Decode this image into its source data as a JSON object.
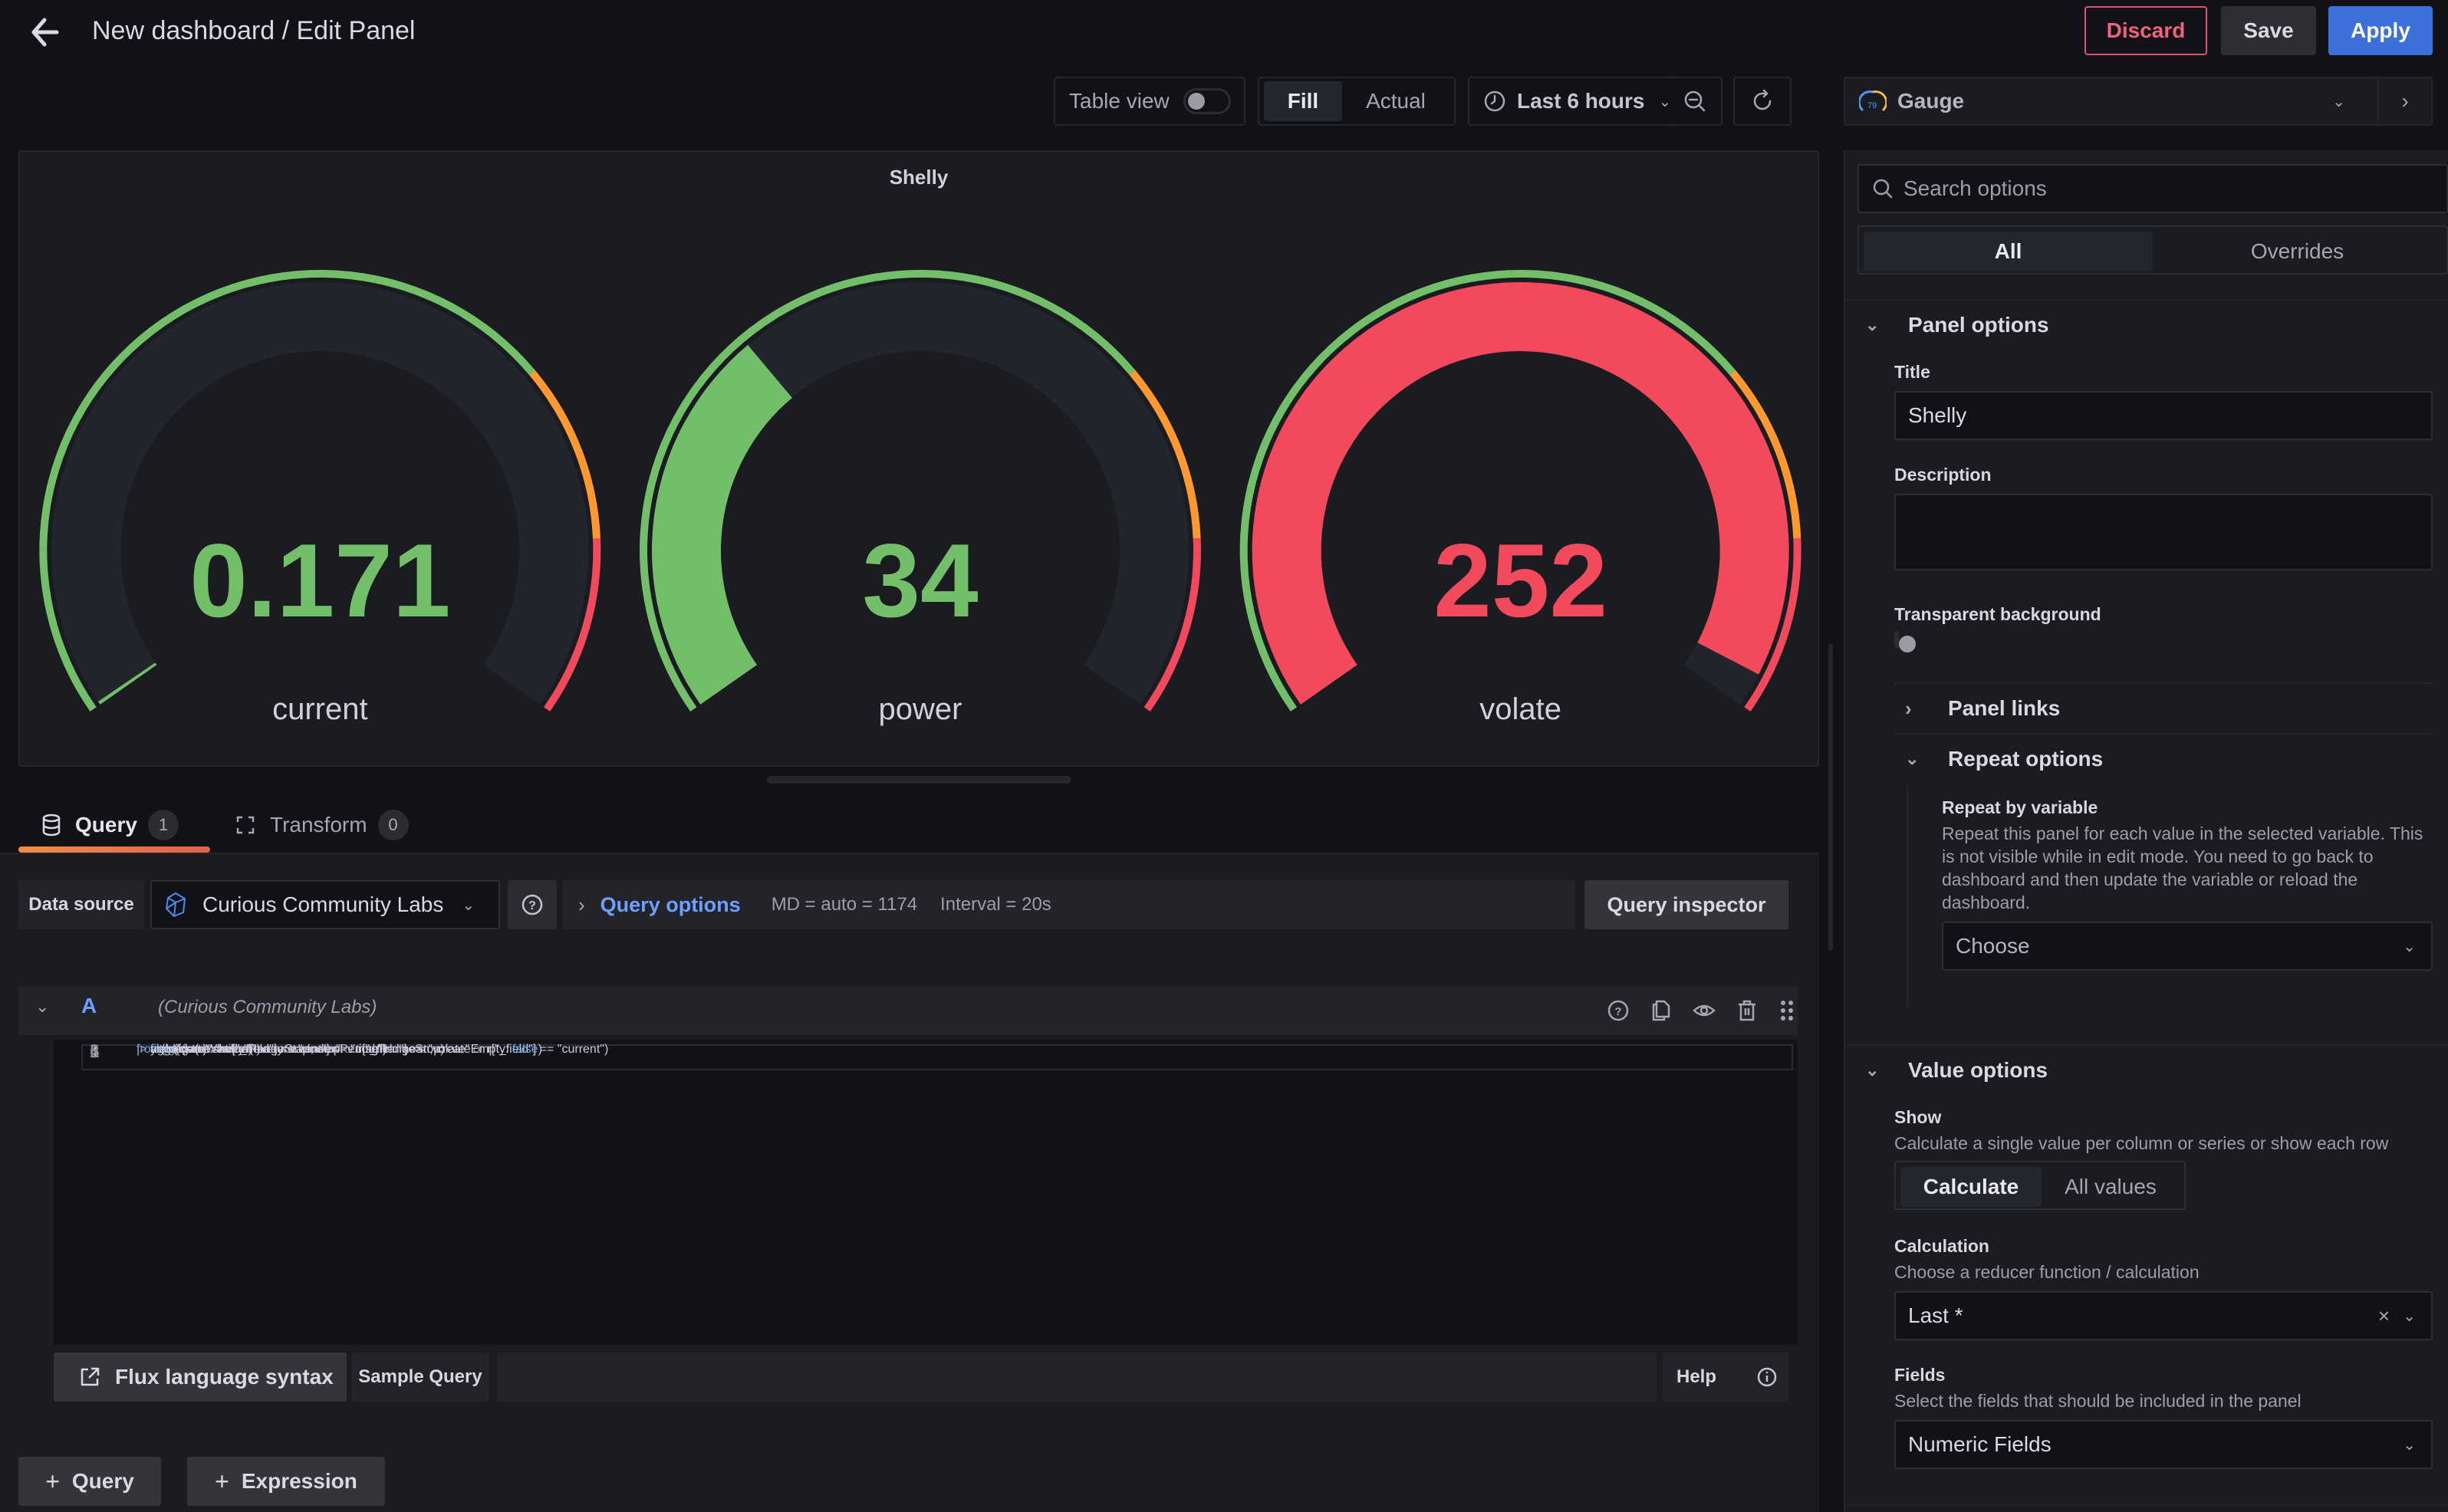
{
  "header": {
    "title": "New dashboard / Edit Panel",
    "discard_label": "Discard",
    "save_label": "Save",
    "apply_label": "Apply"
  },
  "toolbar": {
    "table_view_label": "Table view",
    "table_view_on": false,
    "fill_label": "Fill",
    "actual_label": "Actual",
    "time_range": "Last 6 hours",
    "visualization": "Gauge"
  },
  "panel": {
    "title": "Shelly",
    "gauges": [
      {
        "name": "current",
        "display": "0.171",
        "value": 0.171,
        "min": 0,
        "max": 100,
        "color": "#73bf69"
      },
      {
        "name": "power",
        "display": "34",
        "value": 34,
        "min": 0,
        "max": 100,
        "color": "#73bf69"
      },
      {
        "name": "volate",
        "display": "252",
        "value": 252,
        "min": 0,
        "max": 100,
        "color": "#f2495c"
      }
    ],
    "thresholds": [
      {
        "from_fraction": 0,
        "color": "#73bf69"
      },
      {
        "from_fraction": 0.7,
        "color": "#ff9830"
      },
      {
        "from_fraction": 0.85,
        "color": "#f2495c"
      }
    ]
  },
  "tabs": [
    {
      "label": "Query",
      "count": "1",
      "active": true
    },
    {
      "label": "Transform",
      "count": "0",
      "active": false
    }
  ],
  "query": {
    "data_source_label": "Data source",
    "data_source": "Curious Community Labs",
    "query_options_label": "Query options",
    "md": "MD = auto = 1174",
    "interval": "Interval = 20s",
    "inspector_label": "Query inspector",
    "row_letter": "A",
    "row_datasource": "(Curious Community Labs)",
    "code_lines": [
      "from(bucket: \"shelly\")",
      "  |> range(start: v.timeRangeStart, stop: v.timeRangeStop)",
      "  |> filter(fn: (r) => r[\"_measurement\"] == \"msg\")",
      "  |> filter(fn: (r) => r[\"_field\"] == \"power\" or r[\"_field\"] == \"volate\" or r[\"_field\"] == \"current\")",
      "  |> aggregateWindow(every: v.windowPeriod, fn: mean, createEmpty: false)",
      "  |> yield(name: \"mean\")"
    ],
    "flux_syntax_label": "Flux language syntax",
    "sample_query_label": "Sample Query",
    "help_label": "Help",
    "add_query_label": "Query",
    "add_expression_label": "Expression"
  },
  "options": {
    "search_placeholder": "Search options",
    "tab_all": "All",
    "tab_overrides": "Overrides",
    "panel_options": {
      "heading": "Panel options",
      "title_label": "Title",
      "title_value": "Shelly",
      "description_label": "Description",
      "description_value": "",
      "transparent_label": "Transparent background",
      "transparent_on": false,
      "panel_links": "Panel links",
      "repeat_options": "Repeat options",
      "repeat_by_label": "Repeat by variable",
      "repeat_by_desc": "Repeat this panel for each value in the selected variable. This is not visible while in edit mode. You need to go back to dashboard and then update the variable or reload the dashboard.",
      "repeat_choose": "Choose"
    },
    "value_options": {
      "heading": "Value options",
      "show_label": "Show",
      "show_desc": "Calculate a single value per column or series or show each row",
      "show_calculate": "Calculate",
      "show_all_values": "All values",
      "calc_label": "Calculation",
      "calc_desc": "Choose a reducer function / calculation",
      "calc_value": "Last *",
      "fields_label": "Fields",
      "fields_desc": "Select the fields that should be included in the panel",
      "fields_value": "Numeric Fields"
    }
  }
}
